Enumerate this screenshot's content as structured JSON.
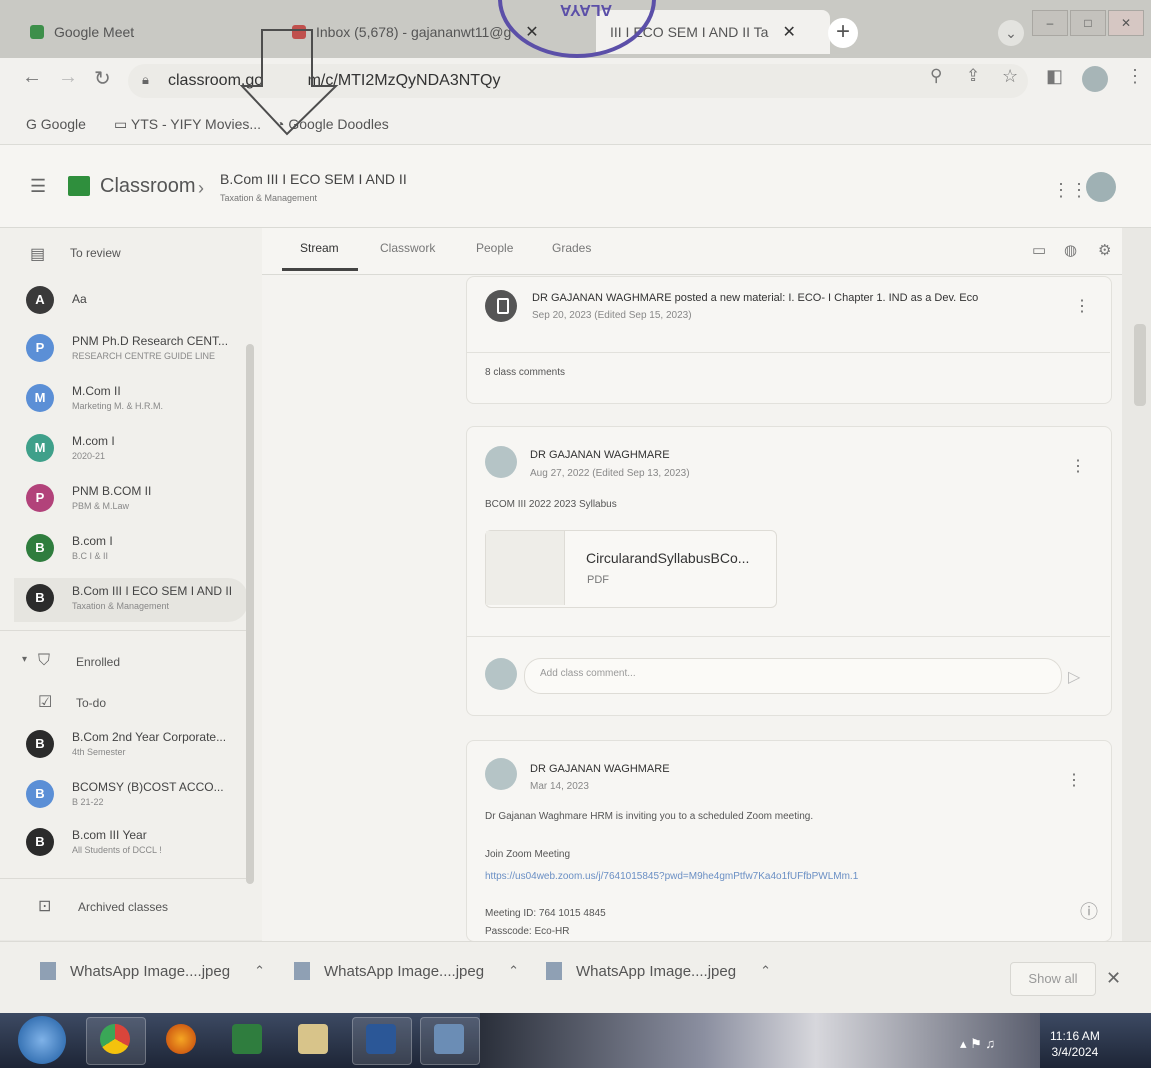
{
  "browser": {
    "tabs": [
      {
        "label": "Google Meet"
      },
      {
        "label": "Inbox (5,678) - gajananwt11@g"
      },
      {
        "label": "III I ECO SEM I AND II Ta"
      }
    ],
    "tab_close": "✕",
    "new_tab": "+",
    "url": "classroom.go          m/c/MTI2MzQyNDA3NTQy",
    "bookmarks": [
      "Google",
      "YTS - YIFY Movies...",
      "Google Doodles"
    ]
  },
  "classroom": {
    "app_name": "Classroom",
    "course_title": "B.Com III I ECO SEM I AND II",
    "course_subtitle": "Taxation & Management",
    "tabs": [
      "Stream",
      "Classwork",
      "People",
      "Grades"
    ]
  },
  "sidebar": {
    "to_review": "To review",
    "classes": [
      {
        "letter": "A",
        "title": "Aa",
        "subtitle": "",
        "color": "#3a3a3a"
      },
      {
        "letter": "P",
        "title": "PNM Ph.D Research CENT...",
        "subtitle": "RESEARCH CENTRE GUIDE LINE",
        "color": "#5b8fd6"
      },
      {
        "letter": "M",
        "title": "M.Com II",
        "subtitle": "Marketing M. & H.R.M.",
        "color": "#5b8fd6"
      },
      {
        "letter": "M",
        "title": "M.com I",
        "subtitle": "2020-21",
        "color": "#3fa08a"
      },
      {
        "letter": "P",
        "title": "PNM B.COM II",
        "subtitle": "PBM & M.Law",
        "color": "#b2427a"
      },
      {
        "letter": "B",
        "title": "B.com I",
        "subtitle": "B.C I & II",
        "color": "#2f7d3e"
      },
      {
        "letter": "B",
        "title": "B.Com III I ECO SEM I AND II",
        "subtitle": "Taxation & Management",
        "color": "#2b2b2b"
      }
    ],
    "enrolled": "Enrolled",
    "todo": "To-do",
    "enrolled_classes": [
      {
        "letter": "B",
        "title": "B.Com 2nd Year Corporate...",
        "subtitle": "4th Semester",
        "color": "#2b2b2b"
      },
      {
        "letter": "B",
        "title": "BCOMSY (B)COST ACCO...",
        "subtitle": "B 21-22",
        "color": "#5b8fd6"
      },
      {
        "letter": "B",
        "title": "B.com III Year",
        "subtitle": "All Students of DCCL !",
        "color": "#2b2b2b"
      }
    ],
    "archived": "Archived classes"
  },
  "stream": {
    "post1": {
      "title": "DR GAJANAN WAGHMARE posted a new material: I. ECO- I Chapter 1. IND as a Dev. Eco",
      "date": "Sep 20, 2023 (Edited Sep 15, 2023)",
      "comments": "8 class comments"
    },
    "post2": {
      "author": "DR GAJANAN WAGHMARE",
      "date": "Aug 27, 2022 (Edited Sep 13, 2023)",
      "text": "BCOM III 2022 2023 Syllabus",
      "attachment_name": "CircularandSyllabusBCo...",
      "attachment_type": "PDF",
      "comment_placeholder": "Add class comment..."
    },
    "post3": {
      "author": "DR GAJANAN WAGHMARE",
      "date": "Mar 14, 2023",
      "line1": "Dr Gajanan Waghmare HRM is inviting you to a scheduled Zoom meeting.",
      "line2": "Join Zoom Meeting",
      "line3": "https://us04web.zoom.us/j/7641015845?pwd=M9he4gmPtfw7Ka4o1fUFfbPWLMm.1",
      "line4": "Meeting ID: 764 1015 4845",
      "line5": "Passcode: Eco-HR"
    }
  },
  "downloads": {
    "items": [
      "WhatsApp Image....jpeg",
      "WhatsApp Image....jpeg",
      "WhatsApp Image....jpeg"
    ],
    "show_all": "Show all"
  },
  "taskbar": {
    "time": "11:16 AM",
    "date": "3/4/2024"
  }
}
